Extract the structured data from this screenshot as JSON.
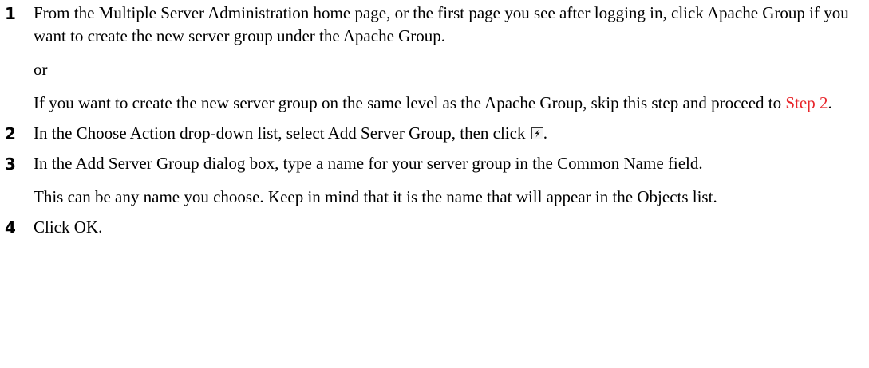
{
  "steps": [
    {
      "number": "1",
      "paragraphs": {
        "p1": "From the Multiple Server Administration home page, or the first page you see after logging in, click Apache Group if you want to create the new server group under the Apache Group.",
        "p2": "or",
        "p3_text": "If you want to create the new server group on the same level as the Apache Group, skip this step and proceed to ",
        "p3_link": "Step 2",
        "p3_end": "."
      }
    },
    {
      "number": "2",
      "paragraphs": {
        "p1_text": "In the Choose Action drop-down list, select Add Server Group, then click ",
        "p1_icon": "execute-icon",
        "p1_end": "."
      }
    },
    {
      "number": "3",
      "paragraphs": {
        "p1": "In the Add Server Group dialog box, type a name for your server group in the Common Name field.",
        "p2": "This can be any name you choose. Keep in mind that it is the name that will appear in the Objects list."
      }
    },
    {
      "number": "4",
      "paragraphs": {
        "p1": "Click OK."
      }
    }
  ],
  "colors": {
    "link": "#e8262b",
    "text": "#000000"
  }
}
